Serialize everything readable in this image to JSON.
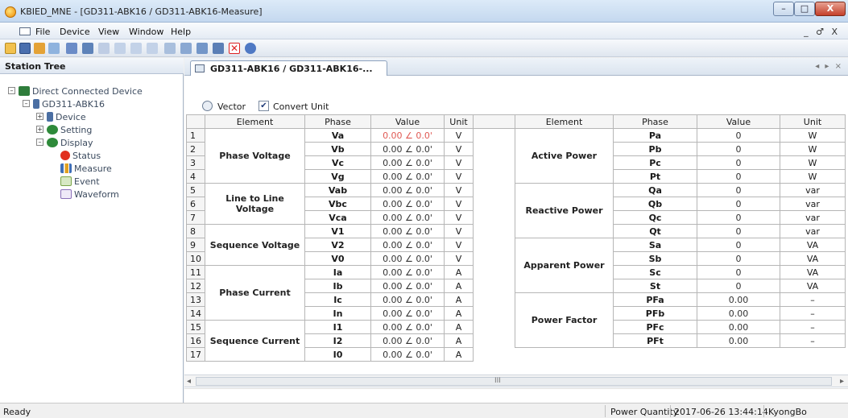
{
  "window": {
    "title": "KBIED_MNE - [GD311-ABK16 / GD311-ABK16-Measure]",
    "min": "–",
    "max": "□",
    "close": "X",
    "mdi_controls": "_ ♂ X"
  },
  "menu": [
    "File",
    "Device",
    "View",
    "Window",
    "Help"
  ],
  "left_panel": {
    "title": "Station Tree",
    "tree": [
      {
        "label": "Direct Connected Device",
        "exp": "–",
        "icon": "network-device-icon",
        "color": "#2f7d3b"
      },
      {
        "label": "GD311-ABK16",
        "exp": "–",
        "icon": "device-icon",
        "color": "#4b6fa3"
      },
      {
        "label": "Device",
        "exp": "+",
        "icon": "device-icon",
        "color": "#4b6fa3"
      },
      {
        "label": "Setting",
        "exp": "+",
        "icon": "gears-icon",
        "color": "#2e8a3a"
      },
      {
        "label": "Display",
        "exp": "–",
        "icon": "gears-icon",
        "color": "#2e8a3a"
      },
      {
        "label": "Status",
        "exp": "",
        "icon": "status-red-circle-icon",
        "color": "#e12f1e"
      },
      {
        "label": "Measure",
        "exp": "",
        "icon": "measure-bar-icon",
        "color": "#3f6fb8"
      },
      {
        "label": "Event",
        "exp": "",
        "icon": "event-table-icon",
        "color": "#7aa34a"
      },
      {
        "label": "Waveform",
        "exp": "",
        "icon": "waveform-icon",
        "color": "#8a6fb8"
      }
    ]
  },
  "tab": {
    "label": "GD311-ABK16 / GD311-ABK16-...",
    "nav": "◂ ▸ ×"
  },
  "options": {
    "vector_label": "Vector",
    "convert_unit_label": "Convert Unit",
    "convert_checked": "✔"
  },
  "table": {
    "left_headers": [
      "Element",
      "Phase",
      "Value",
      "Unit"
    ],
    "right_headers": [
      "Element",
      "Phase",
      "Value",
      "Unit"
    ],
    "left_groups": [
      "Phase Voltage",
      "Line to Line Voltage",
      "Sequence Voltage",
      "Phase Current",
      "Sequence Current"
    ],
    "right_groups": [
      "Active Power",
      "Reactive Power",
      "Apparent Power",
      "Power Factor"
    ],
    "left_rows": [
      {
        "n": "1",
        "phase": "Va",
        "value": "0.00 ∠ 0.0'",
        "unit": "V"
      },
      {
        "n": "2",
        "phase": "Vb",
        "value": "0.00 ∠ 0.0'",
        "unit": "V"
      },
      {
        "n": "3",
        "phase": "Vc",
        "value": "0.00 ∠ 0.0'",
        "unit": "V"
      },
      {
        "n": "4",
        "phase": "Vg",
        "value": "0.00 ∠ 0.0'",
        "unit": "V"
      },
      {
        "n": "5",
        "phase": "Vab",
        "value": "0.00 ∠ 0.0'",
        "unit": "V"
      },
      {
        "n": "6",
        "phase": "Vbc",
        "value": "0.00 ∠ 0.0'",
        "unit": "V"
      },
      {
        "n": "7",
        "phase": "Vca",
        "value": "0.00 ∠ 0.0'",
        "unit": "V"
      },
      {
        "n": "8",
        "phase": "V1",
        "value": "0.00 ∠ 0.0'",
        "unit": "V"
      },
      {
        "n": "9",
        "phase": "V2",
        "value": "0.00 ∠ 0.0'",
        "unit": "V"
      },
      {
        "n": "10",
        "phase": "V0",
        "value": "0.00 ∠ 0.0'",
        "unit": "V"
      },
      {
        "n": "11",
        "phase": "Ia",
        "value": "0.00 ∠ 0.0'",
        "unit": "A"
      },
      {
        "n": "12",
        "phase": "Ib",
        "value": "0.00 ∠ 0.0'",
        "unit": "A"
      },
      {
        "n": "13",
        "phase": "Ic",
        "value": "0.00 ∠ 0.0'",
        "unit": "A"
      },
      {
        "n": "14",
        "phase": "In",
        "value": "0.00 ∠ 0.0'",
        "unit": "A"
      },
      {
        "n": "15",
        "phase": "I1",
        "value": "0.00 ∠ 0.0'",
        "unit": "A"
      },
      {
        "n": "16",
        "phase": "I2",
        "value": "0.00 ∠ 0.0'",
        "unit": "A"
      },
      {
        "n": "17",
        "phase": "I0",
        "value": "0.00 ∠ 0.0'",
        "unit": "A"
      }
    ],
    "right_rows": [
      {
        "phase": "Pa",
        "value": "0",
        "unit": "W"
      },
      {
        "phase": "Pb",
        "value": "0",
        "unit": "W"
      },
      {
        "phase": "Pc",
        "value": "0",
        "unit": "W"
      },
      {
        "phase": "Pt",
        "value": "0",
        "unit": "W"
      },
      {
        "phase": "Qa",
        "value": "0",
        "unit": "var"
      },
      {
        "phase": "Qb",
        "value": "0",
        "unit": "var"
      },
      {
        "phase": "Qc",
        "value": "0",
        "unit": "var"
      },
      {
        "phase": "Qt",
        "value": "0",
        "unit": "var"
      },
      {
        "phase": "Sa",
        "value": "0",
        "unit": "VA"
      },
      {
        "phase": "Sb",
        "value": "0",
        "unit": "VA"
      },
      {
        "phase": "Sc",
        "value": "0",
        "unit": "VA"
      },
      {
        "phase": "St",
        "value": "0",
        "unit": "VA"
      },
      {
        "phase": "PFa",
        "value": "0.00",
        "unit": "–"
      },
      {
        "phase": "PFb",
        "value": "0.00",
        "unit": "–"
      },
      {
        "phase": "PFc",
        "value": "0.00",
        "unit": "–"
      },
      {
        "phase": "PFt",
        "value": "0.00",
        "unit": "–"
      }
    ]
  },
  "scrollbar": {
    "left": "◂",
    "right": "▸",
    "grip": "III"
  },
  "status": {
    "ready": "Ready",
    "power_quantity": "Power Quantity",
    "timestamp": "2017-06-26 13:44:14",
    "user": "KyongBo"
  },
  "colors": {
    "highlight_value": "#e05a54",
    "titlebar": "#c4d8ef"
  }
}
